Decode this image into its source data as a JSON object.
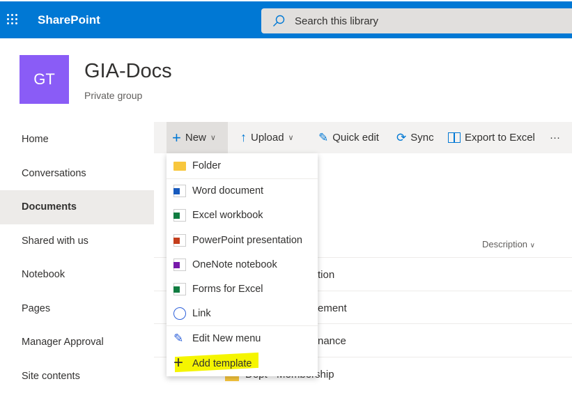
{
  "topbar": {
    "brand": "SharePoint",
    "search_placeholder": "Search this library"
  },
  "site": {
    "logo": "GT",
    "title": "GIA-Docs",
    "subtitle": "Private group"
  },
  "nav": {
    "items": [
      "Home",
      "Conversations",
      "Documents",
      "Shared with us",
      "Notebook",
      "Pages",
      "Manager Approval",
      "Site contents"
    ],
    "selected": "Documents"
  },
  "commandbar": {
    "new": "New",
    "upload": "Upload",
    "quick_edit": "Quick edit",
    "sync": "Sync",
    "export": "Export to Excel",
    "more": "···"
  },
  "list": {
    "column": "Description",
    "rows": [
      "tion",
      "ement",
      "nance",
      "Dept - Membership"
    ]
  },
  "new_menu": {
    "items": [
      {
        "label": "Folder",
        "icon": "folder-icon",
        "color": "#f8c73d"
      },
      {
        "label": "Word document",
        "icon": "word-icon",
        "color": "#185abd"
      },
      {
        "label": "Excel workbook",
        "icon": "excel-icon",
        "color": "#107c41"
      },
      {
        "label": "PowerPoint presentation",
        "icon": "powerpoint-icon",
        "color": "#c43e1c"
      },
      {
        "label": "OneNote notebook",
        "icon": "onenote-icon",
        "color": "#7719aa"
      },
      {
        "label": "Forms for Excel",
        "icon": "excel-icon",
        "color": "#107c41"
      },
      {
        "label": "Link",
        "icon": "globe-icon",
        "color": "#2b5fd9"
      },
      {
        "label": "Edit New menu",
        "icon": "pencil-icon",
        "color": "#2b5fd9"
      },
      {
        "label": "Add template",
        "icon": "plus-icon",
        "color": "#323130"
      }
    ]
  },
  "colors": {
    "brand": "#0078d4",
    "logo": "#8a5cf6",
    "highlight": "#f5f500"
  }
}
